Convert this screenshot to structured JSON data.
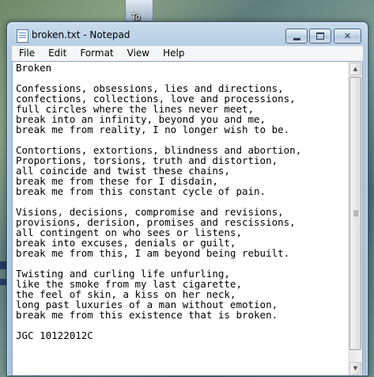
{
  "desktop": {
    "icon_label": "To"
  },
  "window": {
    "title": "broken.txt - Notepad",
    "controls": {
      "minimize": "minimize",
      "maximize": "maximize",
      "close_glyph": "✕"
    }
  },
  "menu": [
    {
      "label": "File"
    },
    {
      "label": "Edit"
    },
    {
      "label": "Format"
    },
    {
      "label": "View"
    },
    {
      "label": "Help"
    }
  ],
  "document": {
    "lines": [
      "Broken",
      "",
      "Confessions, obsessions, lies and directions,",
      "confections, collections, love and processions,",
      "full circles where the lines never meet,",
      "break into an infinity, beyond you and me,",
      "break me from reality, I no longer wish to be.",
      "",
      "Contortions, extortions, blindness and abortion,",
      "Proportions, torsions, truth and distortion,",
      "all coincide and twist these chains,",
      "break me from these for I disdain,",
      "break me from this constant cycle of pain.",
      "",
      "Visions, decisions, compromise and revisions,",
      "provisions, derision, promises and rescissions,",
      "all contingent on who sees or listens,",
      "break into excuses, denials or guilt,",
      "break me from this, I am beyond being rebuilt.",
      "",
      "Twisting and curling life unfurling,",
      "like the smoke from my last cigarette,",
      "the feel of skin, a kiss on her neck,",
      "long past luxuries of a man without emotion,",
      "break me from this existence that is broken.",
      "",
      "JGC 10122012C"
    ]
  },
  "scrollbar": {
    "up_glyph": "▲",
    "down_glyph": "▼"
  }
}
